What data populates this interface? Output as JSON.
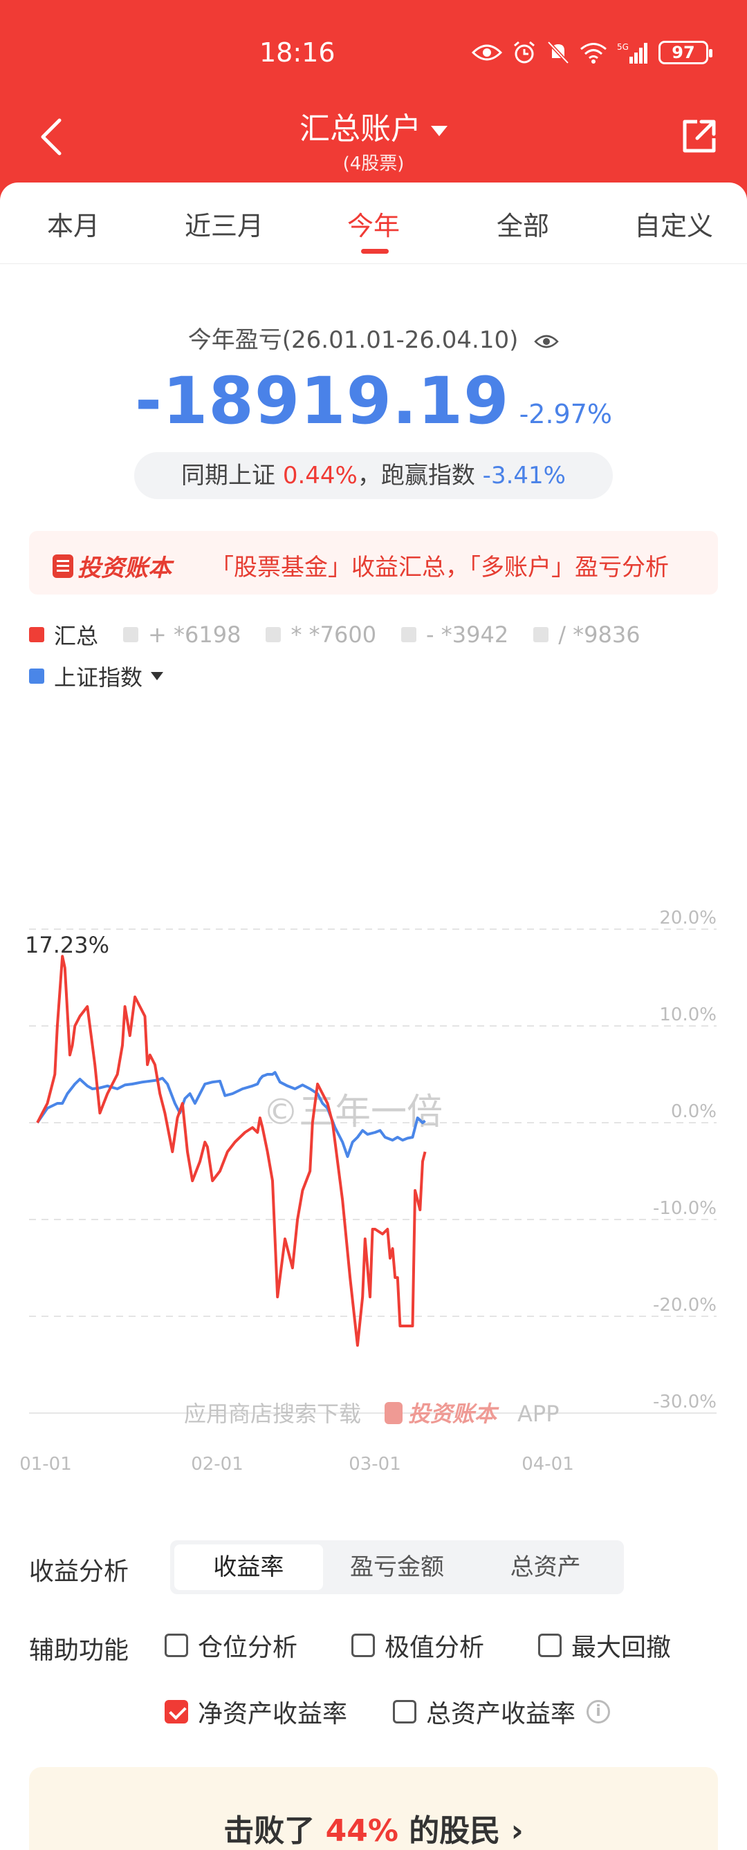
{
  "status_bar": {
    "time": "18:16",
    "battery": "97"
  },
  "nav": {
    "title": "汇总账户",
    "subtitle": "(4股票)"
  },
  "tabs": [
    {
      "label": "本月"
    },
    {
      "label": "近三月"
    },
    {
      "label": "今年"
    },
    {
      "label": "全部"
    },
    {
      "label": "自定义"
    }
  ],
  "summary": {
    "label": "今年盈亏(26.01.01-26.04.10)",
    "amount": "-18919.19",
    "percent": "-2.97%",
    "compare_prefix": "同期上证",
    "compare_index": "0.44%",
    "compare_sep": "，跑赢指数",
    "compare_excess": "-3.41%"
  },
  "banner": {
    "logo": "投资账本",
    "text": "「股票基金」收益汇总，「多账户」盈亏分析"
  },
  "legend": {
    "items": [
      {
        "label": "汇总",
        "color": "#ef3e36",
        "active": true
      },
      {
        "label": "+ *6198",
        "color": "#e3e3e3",
        "active": false
      },
      {
        "label": "* *7600",
        "color": "#e3e3e3",
        "active": false
      },
      {
        "label": "- *3942",
        "color": "#e3e3e3",
        "active": false
      },
      {
        "label": "/ *9836",
        "color": "#e3e3e3",
        "active": false
      }
    ],
    "index": {
      "label": "上证指数",
      "color": "#4a86e8"
    }
  },
  "chart_data": {
    "type": "line",
    "ylim": [
      -30,
      20
    ],
    "yticks": [
      "20.0%",
      "10.0%",
      "0.0%",
      "-10.0%",
      "-20.0%",
      "-30.0%"
    ],
    "xticks": [
      "01-01",
      "02-01",
      "03-01",
      "04-01"
    ],
    "max_label": "17.23%",
    "watermark": "©三年一倍",
    "footer_text": "应用商店搜索下载",
    "footer_logo": "投资账本",
    "footer_app": "APP",
    "series": [
      {
        "name": "汇总",
        "color": "#ef3e36",
        "points": [
          [
            0,
            0
          ],
          [
            2,
            1
          ],
          [
            4,
            2
          ],
          [
            6,
            4
          ],
          [
            7,
            5
          ],
          [
            8,
            10
          ],
          [
            10,
            17.2
          ],
          [
            11,
            16
          ],
          [
            13,
            7
          ],
          [
            14,
            8
          ],
          [
            15,
            10
          ],
          [
            17,
            11
          ],
          [
            20,
            12
          ],
          [
            22,
            8
          ],
          [
            23,
            6
          ],
          [
            25,
            1
          ],
          [
            28,
            3
          ],
          [
            32,
            5
          ],
          [
            34,
            8
          ],
          [
            35,
            12
          ],
          [
            37,
            9
          ],
          [
            39,
            13
          ],
          [
            41,
            12
          ],
          [
            43,
            11
          ],
          [
            44,
            6
          ],
          [
            45,
            7
          ],
          [
            47,
            6
          ],
          [
            49,
            3
          ],
          [
            51,
            1
          ],
          [
            54,
            -3
          ],
          [
            56,
            0.5
          ],
          [
            58,
            2
          ],
          [
            60,
            -3
          ],
          [
            62,
            -6
          ],
          [
            65,
            -4
          ],
          [
            66,
            -3
          ],
          [
            67,
            -2
          ],
          [
            68,
            -2.5
          ],
          [
            70,
            -6
          ],
          [
            73,
            -5
          ],
          [
            76,
            -3
          ],
          [
            79,
            -2
          ],
          [
            83,
            -1
          ],
          [
            86,
            -0.5
          ],
          [
            88,
            -1
          ],
          [
            89,
            0.5
          ],
          [
            90,
            -0.5
          ],
          [
            92,
            -3
          ],
          [
            94,
            -6
          ],
          [
            96,
            -18
          ],
          [
            99,
            -12
          ],
          [
            102,
            -15
          ],
          [
            104,
            -10
          ],
          [
            106,
            -7
          ],
          [
            109,
            -5
          ],
          [
            110,
            0
          ],
          [
            112,
            4
          ],
          [
            114,
            3
          ],
          [
            116,
            2
          ],
          [
            118,
            0
          ],
          [
            122,
            -8
          ],
          [
            125,
            -16
          ],
          [
            128,
            -23
          ],
          [
            130,
            -18
          ],
          [
            131,
            -12
          ],
          [
            132,
            -15
          ],
          [
            133,
            -18
          ],
          [
            134,
            -11
          ],
          [
            135,
            -11
          ],
          [
            138,
            -11.5
          ],
          [
            140,
            -11
          ],
          [
            141,
            -14
          ],
          [
            142,
            -13
          ],
          [
            143,
            -16
          ],
          [
            144,
            -16
          ],
          [
            145,
            -21
          ],
          [
            148,
            -21
          ],
          [
            149,
            -21
          ],
          [
            150,
            -21
          ],
          [
            151,
            -7
          ],
          [
            152,
            -8
          ],
          [
            153,
            -9
          ],
          [
            154,
            -4
          ],
          [
            155,
            -3
          ]
        ]
      },
      {
        "name": "上证指数",
        "color": "#4a86e8",
        "points": [
          [
            0,
            0
          ],
          [
            4,
            1.5
          ],
          [
            8,
            2
          ],
          [
            10,
            2
          ],
          [
            12,
            3
          ],
          [
            15,
            4
          ],
          [
            17,
            4.5
          ],
          [
            20,
            3.8
          ],
          [
            22,
            3.5
          ],
          [
            25,
            3.6
          ],
          [
            28,
            3.8
          ],
          [
            32,
            3.5
          ],
          [
            35,
            3.9
          ],
          [
            38,
            4
          ],
          [
            42,
            4.2
          ],
          [
            45,
            4.3
          ],
          [
            48,
            4.4
          ],
          [
            50,
            4.6
          ],
          [
            52,
            4
          ],
          [
            55,
            2
          ],
          [
            57,
            1
          ],
          [
            59,
            2.5
          ],
          [
            61,
            3
          ],
          [
            63,
            2
          ],
          [
            65,
            3
          ],
          [
            67,
            4
          ],
          [
            70,
            4.2
          ],
          [
            73,
            4.3
          ],
          [
            75,
            2.8
          ],
          [
            78,
            3
          ],
          [
            82,
            3.5
          ],
          [
            86,
            3.8
          ],
          [
            88,
            4
          ],
          [
            89,
            4.5
          ],
          [
            90,
            4.8
          ],
          [
            92,
            5
          ],
          [
            94,
            5
          ],
          [
            95,
            5.2
          ],
          [
            97,
            4.2
          ],
          [
            100,
            3.8
          ],
          [
            103,
            3.5
          ],
          [
            106,
            3.9
          ],
          [
            109,
            3.5
          ],
          [
            112,
            3
          ],
          [
            114,
            2
          ],
          [
            116,
            1.5
          ],
          [
            119,
            -0.5
          ],
          [
            122,
            -2
          ],
          [
            124,
            -3.5
          ],
          [
            126,
            -2
          ],
          [
            128,
            -1.5
          ],
          [
            130,
            -0.8
          ],
          [
            132,
            -1.2
          ],
          [
            135,
            -1
          ],
          [
            137,
            -0.8
          ],
          [
            139,
            -1.5
          ],
          [
            142,
            -1.8
          ],
          [
            144,
            -1.5
          ],
          [
            146,
            -1.8
          ],
          [
            148,
            -1.6
          ],
          [
            150,
            -1.5
          ],
          [
            152,
            0.5
          ],
          [
            154,
            0
          ],
          [
            155,
            0.2
          ]
        ]
      }
    ]
  },
  "analysis": {
    "label": "收益分析",
    "options": [
      "收益率",
      "盈亏金额",
      "总资产"
    ],
    "active": 0
  },
  "aux": {
    "label": "辅助功能",
    "checks": [
      {
        "label": "仓位分析",
        "checked": false
      },
      {
        "label": "极值分析",
        "checked": false
      },
      {
        "label": "最大回撤",
        "checked": false
      },
      {
        "label": "净资产收益率",
        "checked": true
      },
      {
        "label": "总资产收益率",
        "checked": false
      }
    ],
    "info_icon": "i"
  },
  "bottom": {
    "prefix": "击败了",
    "value": "44%",
    "suffix": "的股民"
  }
}
